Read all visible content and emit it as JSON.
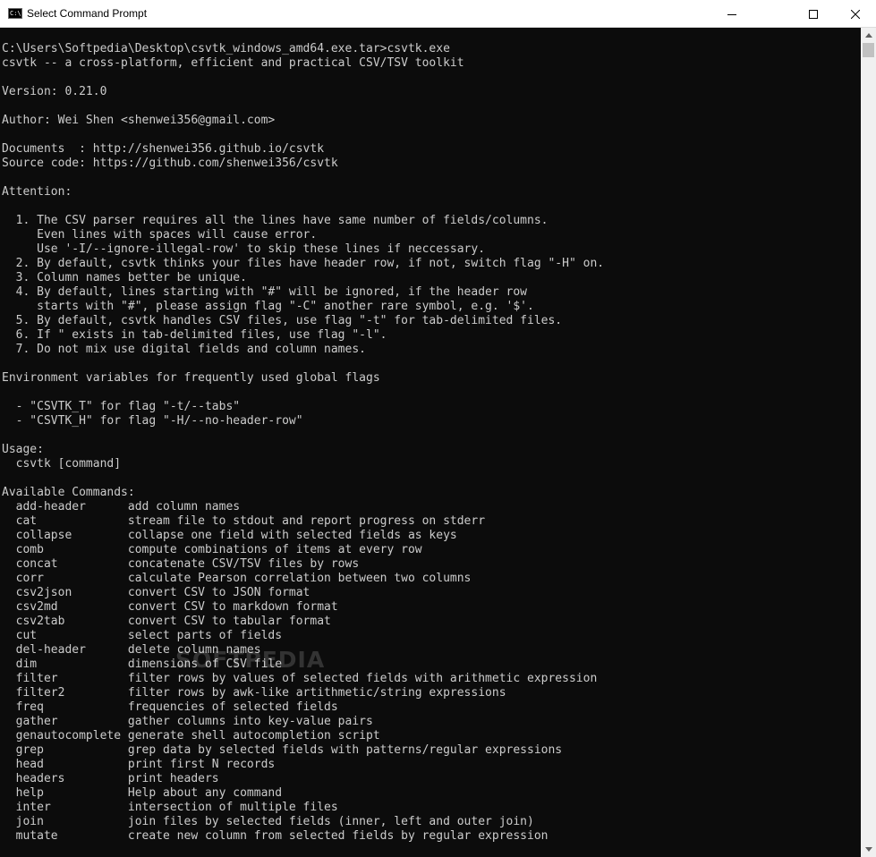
{
  "window": {
    "title": "Select Command Prompt",
    "icon": "cmd-icon",
    "icon_glyph": "C:\\"
  },
  "console": {
    "lines": [
      "C:\\Users\\Softpedia\\Desktop\\csvtk_windows_amd64.exe.tar>csvtk.exe",
      "csvtk -- a cross-platform, efficient and practical CSV/TSV toolkit",
      "",
      "Version: 0.21.0",
      "",
      "Author: Wei Shen <shenwei356@gmail.com>",
      "",
      "Documents  : http://shenwei356.github.io/csvtk",
      "Source code: https://github.com/shenwei356/csvtk",
      "",
      "Attention:",
      "",
      "  1. The CSV parser requires all the lines have same number of fields/columns.",
      "     Even lines with spaces will cause error.",
      "     Use '-I/--ignore-illegal-row' to skip these lines if neccessary.",
      "  2. By default, csvtk thinks your files have header row, if not, switch flag \"-H\" on.",
      "  3. Column names better be unique.",
      "  4. By default, lines starting with \"#\" will be ignored, if the header row",
      "     starts with \"#\", please assign flag \"-C\" another rare symbol, e.g. '$'.",
      "  5. By default, csvtk handles CSV files, use flag \"-t\" for tab-delimited files.",
      "  6. If \" exists in tab-delimited files, use flag \"-l\".",
      "  7. Do not mix use digital fields and column names.",
      "",
      "Environment variables for frequently used global flags",
      "",
      "  - \"CSVTK_T\" for flag \"-t/--tabs\"",
      "  - \"CSVTK_H\" for flag \"-H/--no-header-row\"",
      "",
      "Usage:",
      "  csvtk [command]",
      "",
      "Available Commands:",
      "  add-header      add column names",
      "  cat             stream file to stdout and report progress on stderr",
      "  collapse        collapse one field with selected fields as keys",
      "  comb            compute combinations of items at every row",
      "  concat          concatenate CSV/TSV files by rows",
      "  corr            calculate Pearson correlation between two columns",
      "  csv2json        convert CSV to JSON format",
      "  csv2md          convert CSV to markdown format",
      "  csv2tab         convert CSV to tabular format",
      "  cut             select parts of fields",
      "  del-header      delete column names",
      "  dim             dimensions of CSV file",
      "  filter          filter rows by values of selected fields with arithmetic expression",
      "  filter2         filter rows by awk-like artithmetic/string expressions",
      "  freq            frequencies of selected fields",
      "  gather          gather columns into key-value pairs",
      "  genautocomplete generate shell autocompletion script",
      "  grep            grep data by selected fields with patterns/regular expressions",
      "  head            print first N records",
      "  headers         print headers",
      "  help            Help about any command",
      "  inter           intersection of multiple files",
      "  join            join files by selected fields (inner, left and outer join)",
      "  mutate          create new column from selected fields by regular expression"
    ]
  },
  "watermark": "SOFTPEDIA",
  "colors": {
    "console_background": "#0c0c0c",
    "console_text": "#cccccc",
    "titlebar_background": "#ffffff"
  }
}
